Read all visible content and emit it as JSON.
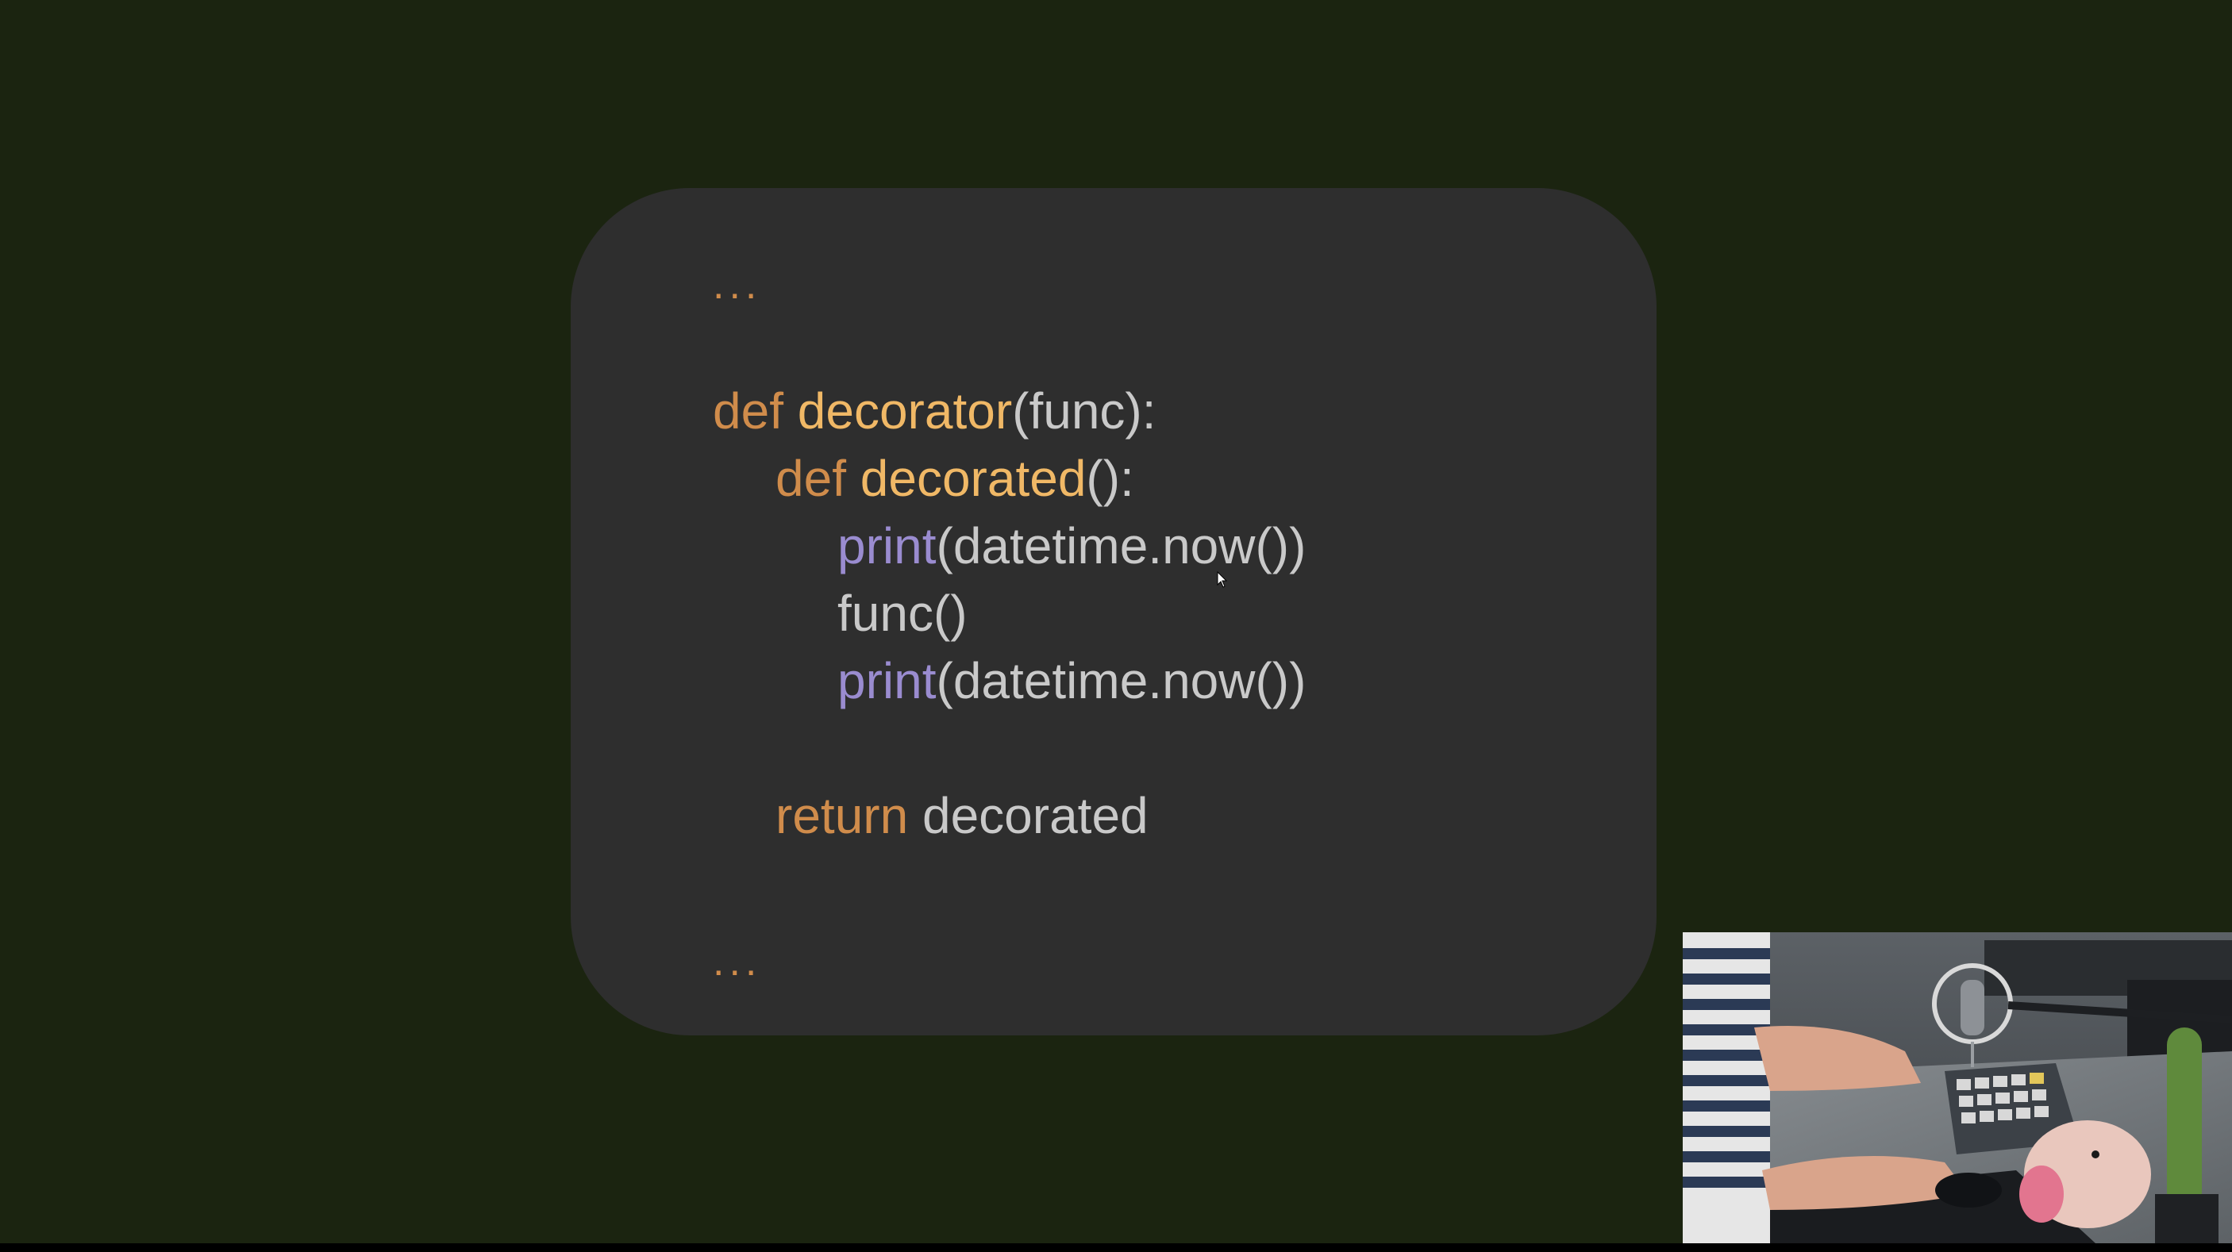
{
  "code": {
    "ellipsis_top": "...",
    "ellipsis_bottom": "...",
    "lines": [
      {
        "kw": "def",
        "name": "decorator",
        "rest": "(func):"
      },
      {
        "kw": "def",
        "name": "decorated",
        "rest": "():"
      },
      {
        "builtin": "print",
        "rest": "(datetime.now())"
      },
      {
        "plain": "func()"
      },
      {
        "builtin": "print",
        "rest": "(datetime.now())"
      },
      {
        "kw": "return",
        "rest": " decorated"
      }
    ]
  },
  "colors": {
    "background": "#1b2410",
    "card": "#2e2e2e",
    "keyword": "#d08c4b",
    "function_name": "#f0b866",
    "builtin": "#9a8cd0",
    "plain": "#c9c9c9"
  },
  "icons": {
    "cursor": "mouse-pointer-icon"
  }
}
